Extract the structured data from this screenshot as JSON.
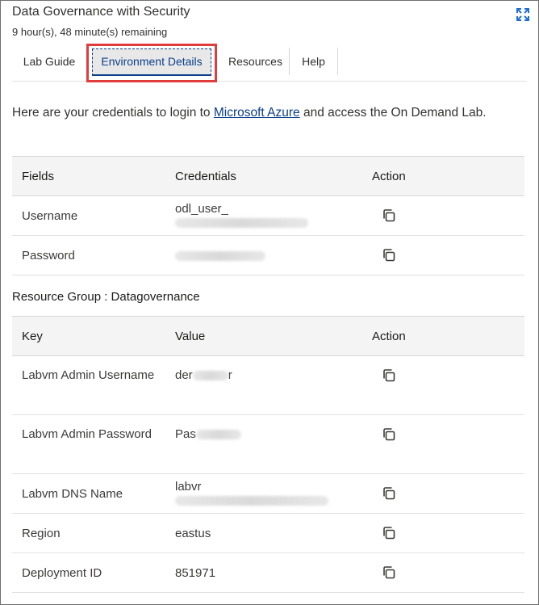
{
  "header": {
    "title": "Data Governance with Security",
    "timer": "9 hour(s), 48 minute(s) remaining"
  },
  "tabs": [
    {
      "label": "Lab Guide"
    },
    {
      "label": "Environment Details",
      "active": true
    },
    {
      "label": "Resources"
    },
    {
      "label": "Help"
    }
  ],
  "intro": {
    "before": "Here are your credentials to login to ",
    "link": "Microsoft Azure",
    "after": " and access the On Demand Lab."
  },
  "credentials": {
    "headers": [
      "Fields",
      "Credentials",
      "Action"
    ],
    "rows": [
      {
        "field": "Username",
        "visible": "odl_user_",
        "blurred": true
      },
      {
        "field": "Password",
        "visible": "",
        "blurred": true
      }
    ]
  },
  "resource_group": {
    "label": "Resource Group : Datagovernance",
    "headers": [
      "Key",
      "Value",
      "Action"
    ],
    "rows": [
      {
        "key": "Labvm Admin Username",
        "value_start": "der",
        "value_end": "r",
        "blurred": true
      },
      {
        "key": "Labvm Admin Password",
        "value_start": "Pas",
        "value_end": "",
        "blurred": true
      },
      {
        "key": "Labvm DNS Name",
        "value_start": "labvr",
        "value_end": "",
        "blurred": true
      },
      {
        "key": "Region",
        "value_start": "eastus",
        "value_end": "",
        "blurred": false
      },
      {
        "key": "Deployment ID",
        "value_start": "851971",
        "value_end": "",
        "blurred": false
      }
    ]
  },
  "icons": {
    "expand": "expand-icon",
    "copy": "copy-icon"
  },
  "colors": {
    "accent": "#0b3f8a",
    "highlight_border": "#e03c3c",
    "header_bg": "#f4f4f4"
  }
}
